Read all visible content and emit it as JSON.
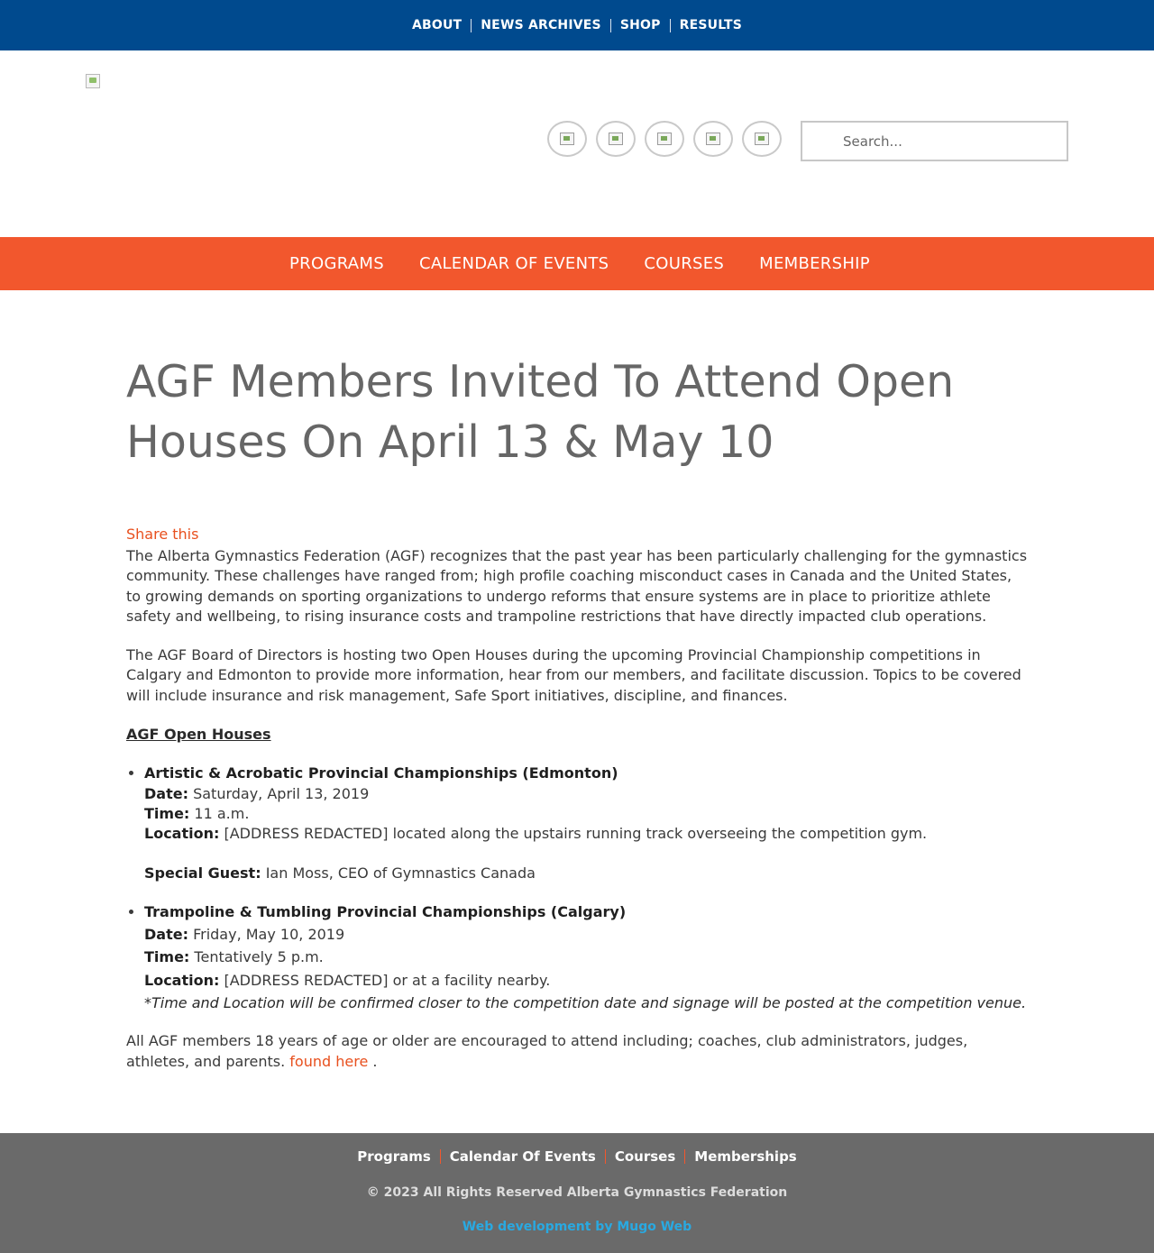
{
  "top_nav": {
    "items": [
      "ABOUT",
      "NEWS ARCHIVES",
      "SHOP",
      "RESULTS"
    ]
  },
  "header": {
    "social_icons": [
      "social-icon-1",
      "social-icon-2",
      "social-icon-3",
      "social-icon-4",
      "social-icon-5"
    ],
    "search_placeholder": "Search..."
  },
  "main_nav": {
    "items": [
      "PROGRAMS",
      "CALENDAR OF EVENTS",
      "COURSES",
      "MEMBERSHIP"
    ]
  },
  "article": {
    "title": "AGF Members Invited To Attend Open Houses On April 13 & May 10",
    "share_label": "Share this",
    "paragraph_1": "The Alberta Gymnastics Federation (AGF) recognizes that the past year has been particularly challenging for the gymnastics community. These challenges have ranged from; high profile coaching misconduct cases in Canada and the United States, to growing demands on sporting organizations to undergo reforms that ensure systems are in place to prioritize athlete safety and wellbeing, to rising insurance costs and trampoline restrictions that have directly impacted club operations.",
    "paragraph_2": "The AGF Board of Directors is hosting two Open Houses during the upcoming Provincial Championship competitions in Calgary and Edmonton to provide more information, hear from our members, and facilitate discussion. Topics to be covered will include insurance and risk management, Safe Sport initiatives, discipline, and finances.",
    "section_heading": "AGF Open Houses",
    "events": [
      {
        "title": "Artistic & Acrobatic Provincial Championships (Edmonton)",
        "date_label": "Date:",
        "date": "Saturday, April 13, 2019",
        "time_label": "Time:",
        "time": "11 a.m.",
        "location_label": "Location:",
        "location": "[ADDRESS REDACTED] located along the upstairs running track overseeing the competition gym.",
        "guest_label": "Special Guest:",
        "guest": "Ian Moss, CEO of Gymnastics Canada"
      },
      {
        "title": "Trampoline & Tumbling Provincial Championships (Calgary)",
        "date_label": "Date:",
        "date": "Friday, May 10, 2019",
        "time_label": "Time:",
        "time": "Tentatively 5 p.m.",
        "location_label": "Location:",
        "location": "[ADDRESS REDACTED] or at a facility nearby.",
        "note": "*Time and Location will be confirmed closer to the competition date and signage will be posted at the competition venue."
      }
    ],
    "closing_text": "All AGF members 18 years of age or older are encouraged to attend including; coaches, club administrators, judges, athletes, and parents.",
    "closing_link": "found here",
    "closing_end": "."
  },
  "footer": {
    "nav": [
      "Programs",
      "Calendar Of Events",
      "Courses",
      "Memberships"
    ],
    "copyright": "© 2023 All Rights Reserved Alberta Gymnastics Federation",
    "credit": "Web development by Mugo Web"
  },
  "colors": {
    "top_bar": "#004a8e",
    "main_nav": "#f2572d",
    "footer": "#6a6a6a",
    "accent_link": "#e8501e",
    "credit_link": "#29a9e1"
  }
}
